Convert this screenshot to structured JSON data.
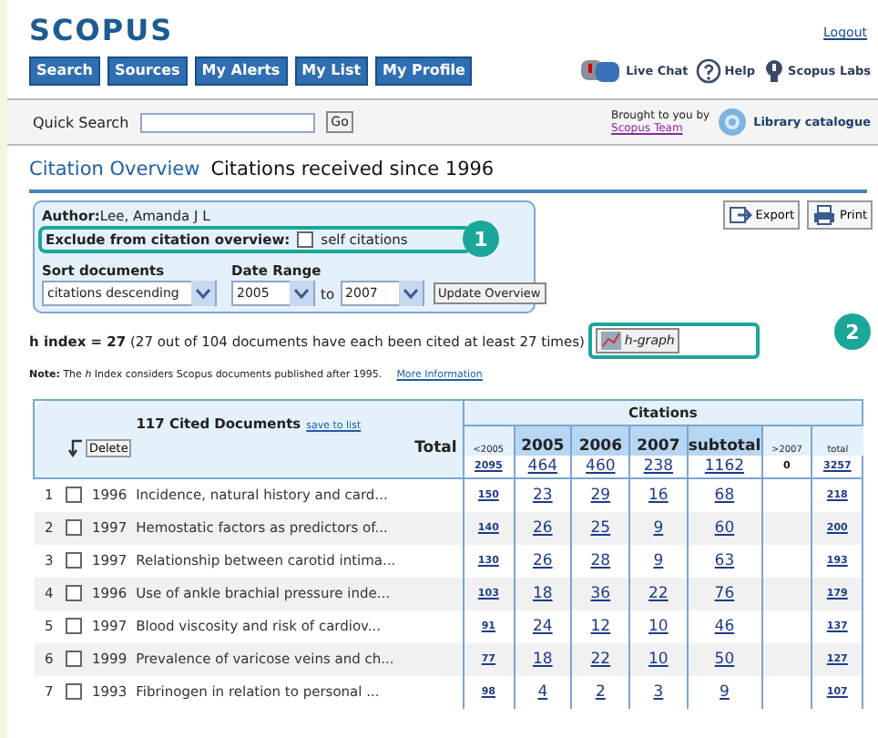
{
  "header": {
    "logo": "SCOPUS",
    "logout": "Logout",
    "tabs": [
      {
        "label": "Search"
      },
      {
        "label": "Sources"
      },
      {
        "label": "My Alerts"
      },
      {
        "label": "My List"
      },
      {
        "label": "My Profile"
      }
    ],
    "links": [
      {
        "kind": "chat",
        "label": "Live Chat"
      },
      {
        "kind": "help",
        "label": "Help"
      },
      {
        "kind": "labs",
        "label": "Scopus Labs"
      }
    ]
  },
  "quick_search": {
    "label": "Quick Search",
    "button": "Go",
    "brought_by": "Brought to you by",
    "team_link": "Scopus Team",
    "library": "Library catalogue"
  },
  "title": {
    "main": "Citation Overview",
    "sub": "Citations received since 1996"
  },
  "actions": [
    {
      "kind": "export",
      "label": "Export"
    },
    {
      "kind": "print",
      "label": "Print"
    }
  ],
  "options": {
    "author_label": "Author:",
    "author": "Lee, Amanda J L",
    "exclude_label": "Exclude from citation overview:",
    "self_citations": {
      "label": "self citations",
      "checked": false
    },
    "sort_label": "Sort documents",
    "sort_value": "citations descending",
    "range_label": "Date Range",
    "from": "2005",
    "to_label": "to",
    "to": "2007",
    "update": "Update Overview"
  },
  "h_index": {
    "text": "**h index = 27** (27 out of 104 documents have each been cited at least 27 times)",
    "graph_button": "h-graph"
  },
  "note": {
    "text": "**Note:** The *h* Index considers Scopus documents published after 1995.",
    "link": "More Information"
  },
  "callouts": [
    "1",
    "2"
  ],
  "table": {
    "title": "117 Cited Documents",
    "save_link": "save to list",
    "delete": "Delete",
    "total_label": "Total",
    "citations_label": "Citations",
    "columns": [
      "<2005",
      "2005",
      "2006",
      "2007",
      "subtotal",
      ">2007",
      "total"
    ],
    "totals": [
      "2095",
      "464",
      "460",
      "238",
      "1162",
      "0",
      "3257"
    ],
    "rows": [
      {
        "n": "1",
        "checked": false,
        "year": "1996",
        "title": "Incidence, natural history and card...",
        "cells": [
          "150",
          "23",
          "29",
          "16",
          "68",
          "",
          "218"
        ]
      },
      {
        "n": "2",
        "checked": false,
        "year": "1997",
        "title": "Hemostatic factors as predictors of...",
        "cells": [
          "140",
          "26",
          "25",
          "9",
          "60",
          "",
          "200"
        ]
      },
      {
        "n": "3",
        "checked": false,
        "year": "1997",
        "title": "Relationship between carotid intima...",
        "cells": [
          "130",
          "26",
          "28",
          "9",
          "63",
          "",
          "193"
        ]
      },
      {
        "n": "4",
        "checked": false,
        "year": "1996",
        "title": "Use of ankle brachial pressure inde...",
        "cells": [
          "103",
          "18",
          "36",
          "22",
          "76",
          "",
          "179"
        ]
      },
      {
        "n": "5",
        "checked": false,
        "year": "1997",
        "title": "Blood viscosity and risk of cardiov...",
        "cells": [
          "91",
          "24",
          "12",
          "10",
          "46",
          "",
          "137"
        ]
      },
      {
        "n": "6",
        "checked": false,
        "year": "1999",
        "title": "Prevalence of varicose veins and ch...",
        "cells": [
          "77",
          "18",
          "22",
          "10",
          "50",
          "",
          "127"
        ]
      },
      {
        "n": "7",
        "checked": false,
        "year": "1993",
        "title": "Fibrinogen in relation to personal ...",
        "cells": [
          "98",
          "4",
          "2",
          "3",
          "9",
          "",
          "107"
        ]
      }
    ]
  }
}
